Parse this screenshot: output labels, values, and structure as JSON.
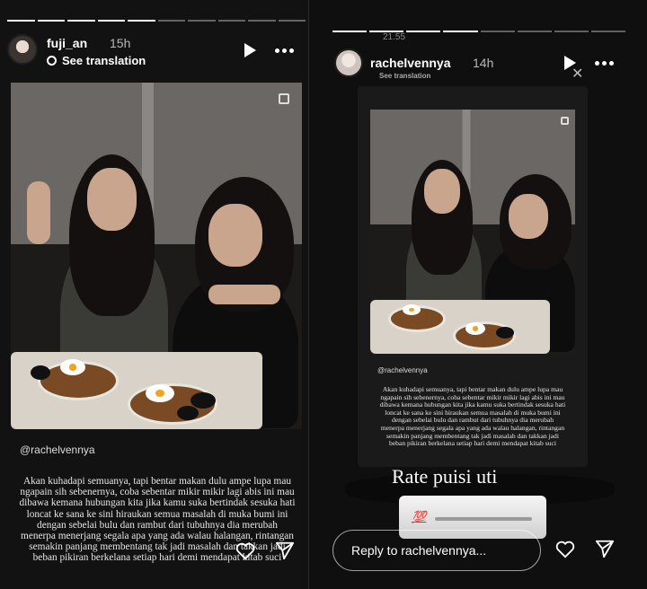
{
  "left": {
    "username": "fuji_an",
    "time": "15h",
    "translate_label": "See translation",
    "mention": "@rachelvennya",
    "poem": "Akan kuhadapi semuanya, tapi bentar makan dulu ampe lupa mau\nngapain sih sebenernya, coba sebentar mikir mikir lagi abis ini mau\ndibawa kemana hubungan kita jika kamu suka bertindak sesuka hati\nloncat ke sana ke sini hiraukan semua masalah di muka bumi ini\ndengan sebelai bulu dan rambut dari tubuhnya dia merubah\nmenerpa menerjang segala apa yang ada walau halangan, rintangan\nsemakin panjang membentang tak jadi masalah dan takkan jadi\nbeban pikiran berkelana setiap hari demi mendapat kitab suci",
    "icons": [
      "play-icon",
      "more-icon",
      "copy-icon",
      "heart-icon",
      "send-icon"
    ]
  },
  "right": {
    "status_time": "21.55",
    "username": "rachelvennya",
    "time": "14h",
    "translate_label": "See translation",
    "mention": "@rachelvennya",
    "poem": "Akan kuhadapi semuanya, tapi bentar makan dulu ampe lupa mau\nngapain sih sebenernya, coba sebentar mikir mikir lagi abis ini mau\ndibawa kemana hubungan kita jika kamu suka bertindak sesuka hati\nloncat ke sana ke sini hiraukan semua masalah di muka bumi ini\ndengan sebelai bulu dan rambut dari tubuhnya dia merubah\nmenerpa menerjang segala apa yang ada walau halangan, rintangan\nsemakin panjang membentang tak jadi masalah dan takkan jadi\nbeban pikiran berkelana setiap hari demi mendapat kitab suci",
    "caption": "Rate puisi uti",
    "sticker_emoji": "💯",
    "reply_placeholder": "Reply to rachelvennya...",
    "icons": [
      "play-icon",
      "close-icon",
      "more-icon",
      "heart-icon",
      "send-icon"
    ]
  }
}
